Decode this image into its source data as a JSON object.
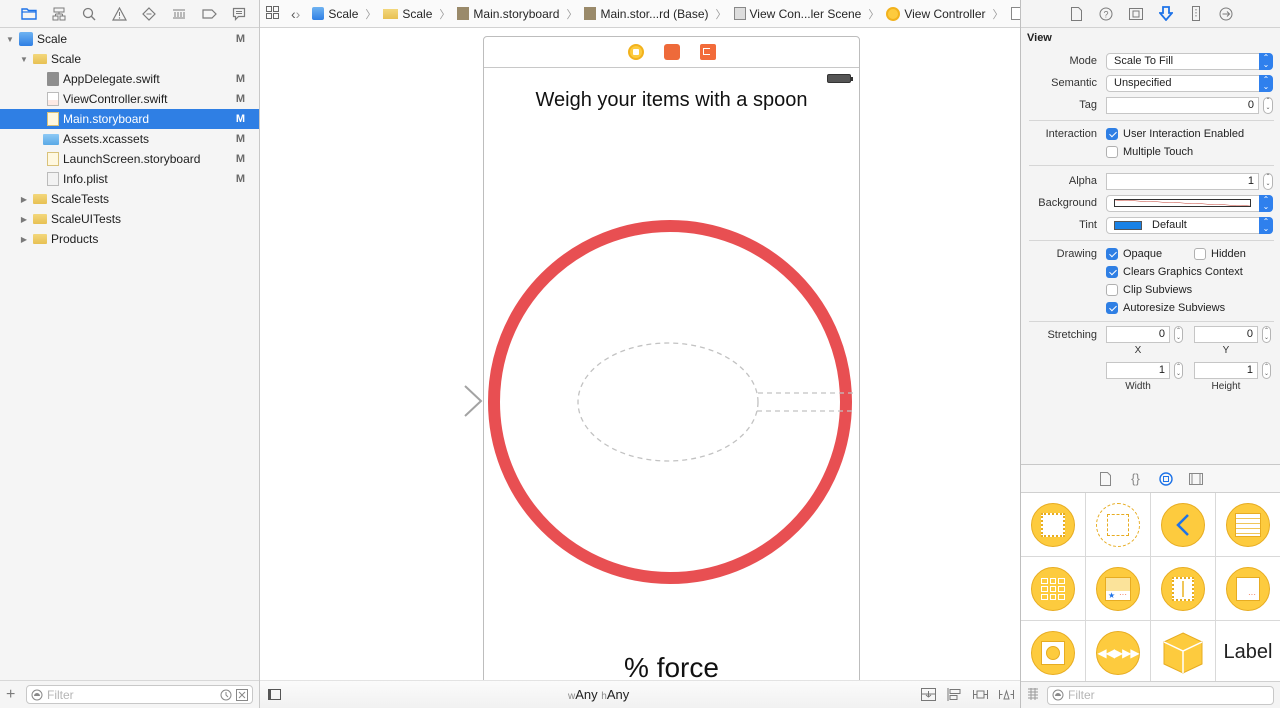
{
  "navigator": {
    "toolbar_icons": [
      "folder-icon",
      "hierarchy-icon",
      "search-icon",
      "warning-icon",
      "test-diamond-icon",
      "debug-bars-icon",
      "breakpoint-icon",
      "report-bubble-icon"
    ],
    "tree": [
      {
        "label": "Scale",
        "badge": "M",
        "icon": "project-icon",
        "depth": 0,
        "expanded": true
      },
      {
        "label": "Scale",
        "badge": "",
        "icon": "folder-icon",
        "depth": 1,
        "expanded": true
      },
      {
        "label": "AppDelegate.swift",
        "badge": "M",
        "icon": "swift-file-icon",
        "depth": 2
      },
      {
        "label": "ViewController.swift",
        "badge": "M",
        "icon": "swift-file-icon",
        "depth": 2
      },
      {
        "label": "Main.storyboard",
        "badge": "M",
        "icon": "storyboard-file-icon",
        "depth": 2,
        "selected": true
      },
      {
        "label": "Assets.xcassets",
        "badge": "M",
        "icon": "asset-folder-icon",
        "depth": 2
      },
      {
        "label": "LaunchScreen.storyboard",
        "badge": "M",
        "icon": "storyboard-file-icon",
        "depth": 2
      },
      {
        "label": "Info.plist",
        "badge": "M",
        "icon": "plist-file-icon",
        "depth": 2
      },
      {
        "label": "ScaleTests",
        "badge": "",
        "icon": "folder-icon",
        "depth": 1,
        "expanded": false
      },
      {
        "label": "ScaleUITests",
        "badge": "",
        "icon": "folder-icon",
        "depth": 1,
        "expanded": false
      },
      {
        "label": "Products",
        "badge": "",
        "icon": "folder-icon",
        "depth": 1,
        "expanded": false
      }
    ],
    "filter_placeholder": "Filter"
  },
  "jumpbar": {
    "crumbs": [
      "Scale",
      "Scale",
      "Main.storyboard",
      "Main.stor...rd (Base)",
      "View Con...ler Scene",
      "View Controller",
      "View"
    ]
  },
  "canvas": {
    "scene_title": "Weigh your items with a spoon",
    "scene_footer": "% force",
    "ring_color": "#e84f52",
    "size_class": {
      "w_prefix": "w",
      "w_value": "Any",
      "h_prefix": "h",
      "h_value": "Any"
    }
  },
  "inspector": {
    "section": "View",
    "mode": {
      "label": "Mode",
      "value": "Scale To Fill"
    },
    "semantic": {
      "label": "Semantic",
      "value": "Unspecified"
    },
    "tag": {
      "label": "Tag",
      "value": "0"
    },
    "interaction": {
      "label": "Interaction",
      "options": [
        {
          "label": "User Interaction Enabled",
          "checked": true
        },
        {
          "label": "Multiple Touch",
          "checked": false
        }
      ]
    },
    "alpha": {
      "label": "Alpha",
      "value": "1"
    },
    "background": {
      "label": "Background"
    },
    "tint": {
      "label": "Tint",
      "value": "Default",
      "color": "#1a82e6"
    },
    "drawing": {
      "label": "Drawing",
      "options": [
        {
          "label": "Opaque",
          "checked": true
        },
        {
          "label": "Hidden",
          "checked": false
        },
        {
          "label": "Clears Graphics Context",
          "checked": true
        },
        {
          "label": "Clip Subviews",
          "checked": false
        },
        {
          "label": "Autoresize Subviews",
          "checked": true
        }
      ]
    },
    "stretching": {
      "label": "Stretching",
      "x": "0",
      "y": "0",
      "width": "1",
      "height": "1",
      "x_label": "X",
      "y_label": "Y",
      "width_label": "Width",
      "height_label": "Height"
    }
  },
  "library": {
    "tabs": [
      "file-template-icon",
      "code-snippet-icon",
      "object-library-icon",
      "media-library-icon"
    ],
    "items": [
      "view-controller",
      "storyboard-reference",
      "navigation-controller",
      "table-view-controller",
      "collection-view-controller",
      "tab-bar-controller",
      "split-view-controller",
      "page-view-controller",
      "glkit-view-controller",
      "avkit-player-view-controller",
      "object",
      "label"
    ],
    "label_item_text": "Label",
    "filter_placeholder": "Filter"
  }
}
